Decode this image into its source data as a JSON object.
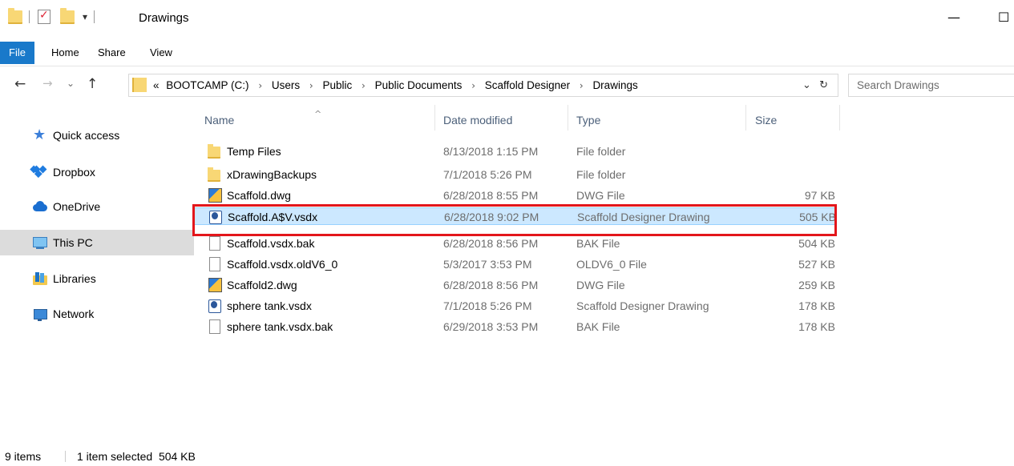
{
  "window": {
    "title": "Drawings",
    "minimize_glyph": "—",
    "maximize_glyph": "☐"
  },
  "quick_access_toolbar": {
    "icons": [
      "folder-icon",
      "properties-check-icon",
      "new-folder-icon",
      "customize-dropdown-icon"
    ],
    "dropdown_glyph": "▾"
  },
  "ribbon": {
    "tabs": [
      {
        "label": "File"
      },
      {
        "label": "Home"
      },
      {
        "label": "Share"
      },
      {
        "label": "View"
      }
    ]
  },
  "navigation": {
    "back_glyph": "←",
    "forward_glyph": "→",
    "recent_glyph": "⌄",
    "up_glyph": "↑"
  },
  "address_bar": {
    "overflow_glyph": "«",
    "separator_glyph": "›",
    "crumbs": [
      "BOOTCAMP (C:)",
      "Users",
      "Public",
      "Public Documents",
      "Scaffold Designer",
      "Drawings"
    ],
    "dropdown_glyph": "⌄",
    "refresh_glyph": "↻"
  },
  "search": {
    "placeholder": "Search Drawings"
  },
  "nav_pane": {
    "items": [
      {
        "label": "Quick access",
        "icon": "star-icon"
      },
      {
        "label": "Dropbox",
        "icon": "dropbox-icon"
      },
      {
        "label": "OneDrive",
        "icon": "cloud-icon"
      },
      {
        "label": "This PC",
        "icon": "computer-icon",
        "selected": true
      },
      {
        "label": "Libraries",
        "icon": "libraries-icon"
      },
      {
        "label": "Network",
        "icon": "network-icon"
      }
    ]
  },
  "file_list": {
    "sort_glyph": "^",
    "columns": [
      "Name",
      "Date modified",
      "Type",
      "Size"
    ],
    "rows": [
      {
        "name": "Temp Files",
        "date": "8/13/2018 1:15 PM",
        "type": "File folder",
        "size": "",
        "icon": "folder-icon"
      },
      {
        "name": "xDrawingBackups",
        "date": "7/1/2018 5:26 PM",
        "type": "File folder",
        "size": "",
        "icon": "folder-icon"
      },
      {
        "name": "Scaffold.dwg",
        "date": "6/28/2018 8:55 PM",
        "type": "DWG File",
        "size": "97 KB",
        "icon": "dwg-file-icon"
      },
      {
        "name": "Scaffold.A$V.vsdx",
        "date": "6/28/2018 9:02 PM",
        "type": "Scaffold Designer Drawing",
        "size": "505 KB",
        "icon": "vsdx-file-icon",
        "selected": true
      },
      {
        "name": "Scaffold.vsdx.bak",
        "date": "6/28/2018 8:56 PM",
        "type": "BAK File",
        "size": "504 KB",
        "icon": "file-icon"
      },
      {
        "name": "Scaffold.vsdx.oldV6_0",
        "date": "5/3/2017 3:53 PM",
        "type": "OLDV6_0 File",
        "size": "527 KB",
        "icon": "file-icon"
      },
      {
        "name": "Scaffold2.dwg",
        "date": "6/28/2018 8:56 PM",
        "type": "DWG File",
        "size": "259 KB",
        "icon": "dwg-file-icon"
      },
      {
        "name": "sphere tank.vsdx",
        "date": "7/1/2018 5:26 PM",
        "type": "Scaffold Designer Drawing",
        "size": "178 KB",
        "icon": "vsdx-file-icon"
      },
      {
        "name": "sphere tank.vsdx.bak",
        "date": "6/29/2018 3:53 PM",
        "type": "BAK File",
        "size": "178 KB",
        "icon": "file-icon"
      }
    ]
  },
  "status_bar": {
    "item_count": "9 items",
    "selection": "1 item selected  504 KB"
  },
  "colors": {
    "file_tab": "#1979ca",
    "selection_fill": "#cce8ff",
    "highlight_box": "#e3161b"
  }
}
